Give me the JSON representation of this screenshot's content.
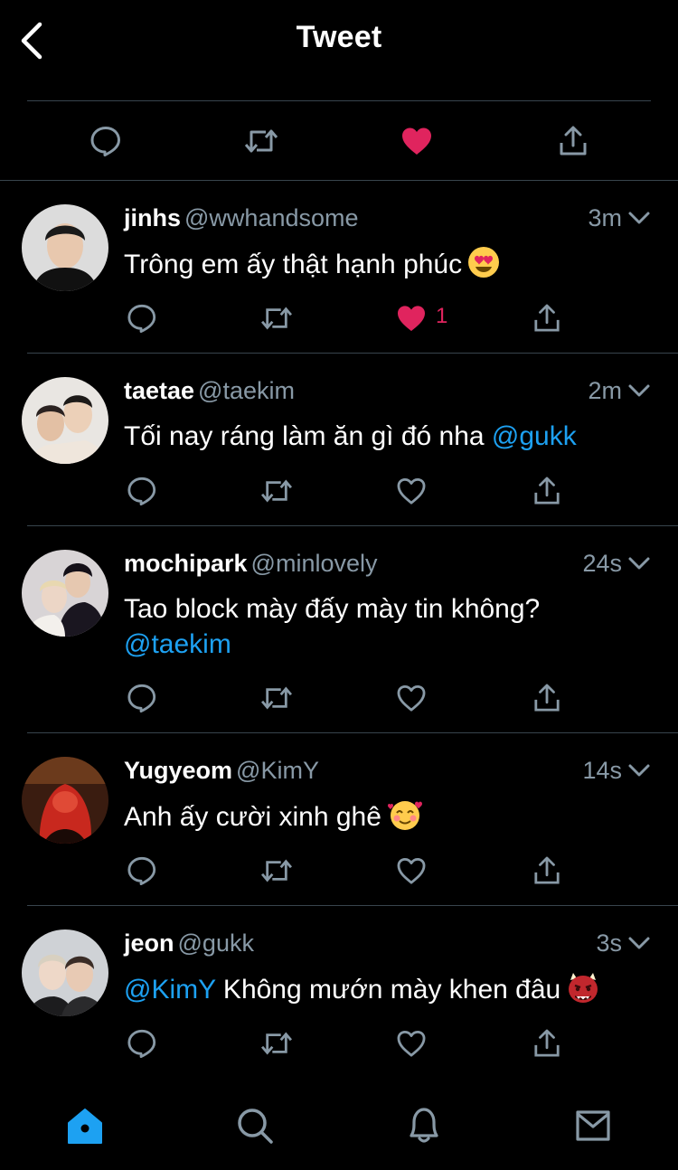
{
  "header": {
    "title": "Tweet"
  },
  "colors": {
    "accent": "#1da1f2",
    "like": "#e0245e",
    "secondary": "#8899a6",
    "divider": "#38444d",
    "background": "#000000"
  },
  "main_actions": [
    "reply-icon",
    "retweet-icon",
    "heart-filled-icon",
    "share-icon"
  ],
  "replies": [
    {
      "name": "jinhs",
      "handle": "@wwhandsome",
      "time": "3m",
      "text": "Trông em ấy thật hạnh phúc",
      "emoji": "heart-eyes-emoji",
      "liked": true,
      "like_count": "1"
    },
    {
      "name": "taetae",
      "handle": "@taekim",
      "time": "2m",
      "text": "Tối nay ráng làm ăn gì đó nha ",
      "mention": "@gukk",
      "liked": false
    },
    {
      "name": "mochipark",
      "handle": "@minlovely",
      "time": "24s",
      "text": "Tao block mày đấy mày tin không?",
      "mention": "@taekim",
      "liked": false
    },
    {
      "name": "Yugyeom",
      "handle": "@KimY",
      "time": "14s",
      "text": "Anh ấy cười xinh ghê",
      "emoji": "smiling-hearts-emoji",
      "liked": false
    },
    {
      "name": "jeon",
      "handle": "@gukk",
      "time": "3s",
      "mention": "@KimY",
      "text": " Không mướn mày khen đâu",
      "emoji": "ogre-emoji",
      "liked": false
    }
  ],
  "tabbar": [
    "home-icon",
    "search-icon",
    "bell-icon",
    "mail-icon"
  ]
}
